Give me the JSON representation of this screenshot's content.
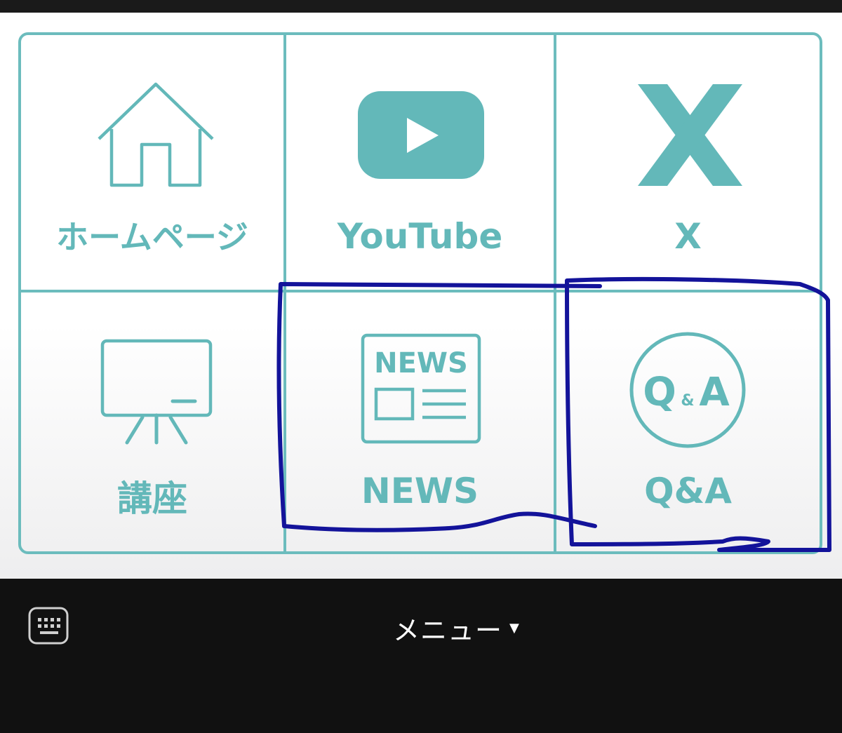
{
  "colors": {
    "accent": "#63b8b9",
    "annotation": "#13139a",
    "bottom_bar": "#111111"
  },
  "menu": {
    "items": [
      {
        "label": "ホームページ",
        "icon": "home-icon"
      },
      {
        "label": "YouTube",
        "icon": "youtube-icon"
      },
      {
        "label": "X",
        "icon": "x-logo-icon"
      },
      {
        "label": "講座",
        "icon": "presentation-board-icon"
      },
      {
        "label": "NEWS",
        "icon": "newspaper-icon",
        "icon_text": "NEWS"
      },
      {
        "label": "Q&A",
        "icon": "qa-circle-icon",
        "icon_text_q": "Q",
        "icon_text_amp": "&",
        "icon_text_a": "A"
      }
    ]
  },
  "bottom_bar": {
    "keyboard_icon": "keyboard-icon",
    "menu_label": "メニュー",
    "caret": "▼"
  }
}
